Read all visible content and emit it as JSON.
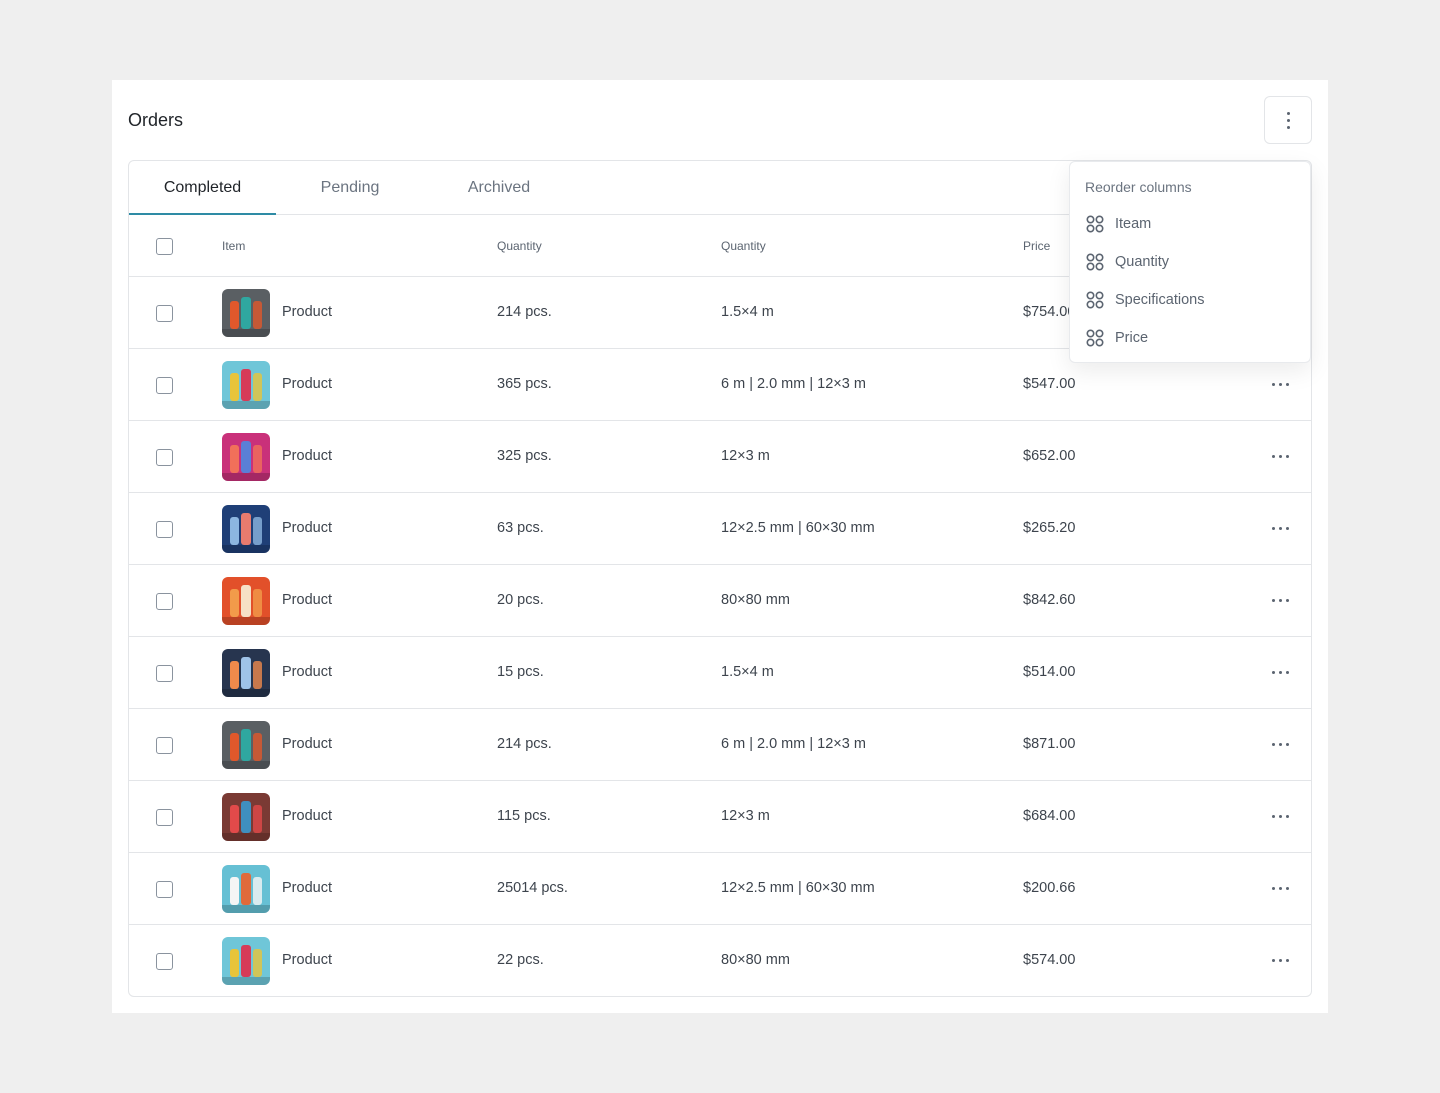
{
  "page": {
    "title": "Orders"
  },
  "tabs": [
    {
      "label": "Completed",
      "active": true
    },
    {
      "label": "Pending",
      "active": false
    },
    {
      "label": "Archived",
      "active": false
    }
  ],
  "table": {
    "columns": [
      "Item",
      "Quantity",
      "Quantity",
      "Price"
    ],
    "rows": [
      {
        "name": "Product",
        "quantity": "214 pcs.",
        "spec": "1.5×4 m",
        "price": "$754.00",
        "thumb": [
          "#5a5f63",
          "#e0582b",
          "#2fa7a0"
        ]
      },
      {
        "name": "Product",
        "quantity": "365 pcs.",
        "spec": "6 m | 2.0 mm | 12×3 m",
        "price": "$547.00",
        "thumb": [
          "#6fc6d8",
          "#e8c43a",
          "#d63b58"
        ]
      },
      {
        "name": "Product",
        "quantity": "325 pcs.",
        "spec": "12×3 m",
        "price": "$652.00",
        "thumb": [
          "#c9317a",
          "#f1705a",
          "#5a7fd6"
        ]
      },
      {
        "name": "Product",
        "quantity": "63 pcs.",
        "spec": "12×2.5 mm | 60×30 mm",
        "price": "$265.20",
        "thumb": [
          "#1f3f77",
          "#8cb6e0",
          "#e87b6e"
        ]
      },
      {
        "name": "Product",
        "quantity": "20 pcs.",
        "spec": "80×80 mm",
        "price": "$842.60",
        "thumb": [
          "#e2502a",
          "#f29b4a",
          "#f6e0c5"
        ]
      },
      {
        "name": "Product",
        "quantity": "15 pcs.",
        "spec": "1.5×4 m",
        "price": "$514.00",
        "thumb": [
          "#27354f",
          "#f08a4b",
          "#9fc3e8"
        ]
      },
      {
        "name": "Product",
        "quantity": "214 pcs.",
        "spec": "6 m | 2.0 mm | 12×3 m",
        "price": "$871.00",
        "thumb": [
          "#5a5f63",
          "#e0582b",
          "#2fa7a0"
        ]
      },
      {
        "name": "Product",
        "quantity": "115 pcs.",
        "spec": "12×3 m",
        "price": "$684.00",
        "thumb": [
          "#7a3a34",
          "#e24a4a",
          "#3f8fbf"
        ]
      },
      {
        "name": "Product",
        "quantity": "25014 pcs.",
        "spec": "12×2.5 mm | 60×30 mm",
        "price": "$200.66",
        "thumb": [
          "#66c0d4",
          "#f5f5f5",
          "#e06a3b"
        ]
      },
      {
        "name": "Product",
        "quantity": "22 pcs.",
        "spec": "80×80 mm",
        "price": "$574.00",
        "thumb": [
          "#6fc6d8",
          "#e8c43a",
          "#d63b58"
        ]
      }
    ]
  },
  "reorder_menu": {
    "title": "Reorder columns",
    "items": [
      "Iteam",
      "Quantity",
      "Specifications",
      "Price"
    ]
  },
  "icons": {
    "menu_button": "more-vertical-icon",
    "row_action": "more-horizontal-icon",
    "drag_handle": "grid-handle-icon"
  },
  "colors": {
    "accent": "#2e8ba5",
    "background": "#efefef",
    "border": "#e3e5e8"
  }
}
